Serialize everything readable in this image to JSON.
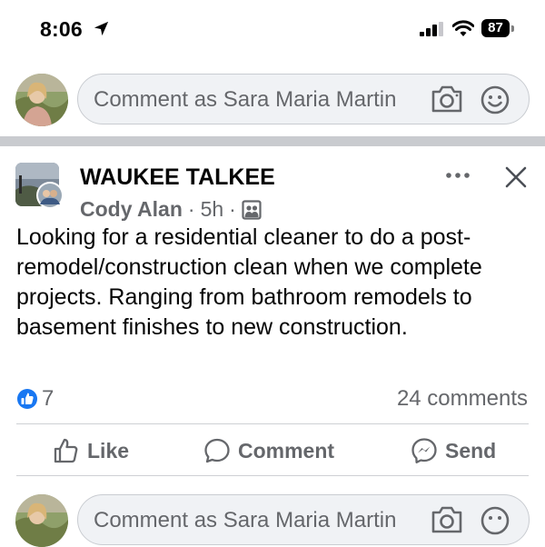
{
  "status_bar": {
    "time": "8:06",
    "battery": "87"
  },
  "top_comment": {
    "placeholder": "Comment as Sara Maria Martin"
  },
  "post": {
    "group_name": "WAUKEE TALKEE",
    "author": "Cody Alan",
    "separator": "·",
    "age": "5h",
    "text": "Looking for a residential cleaner to do a post-remodel/construction clean when we complete projects. Ranging from bathroom remodels to basement finishes to new construction.",
    "like_count": "7",
    "comment_count": "24 comments"
  },
  "actions": {
    "like": "Like",
    "comment": "Comment",
    "send": "Send"
  },
  "bottom_comment": {
    "placeholder": "Comment as Sara Maria Martin"
  },
  "colors": {
    "like_blue": "#1877f2",
    "muted": "#65676b"
  },
  "icons": [
    "location-arrow-icon",
    "signal-icon",
    "wifi-icon",
    "battery-icon",
    "camera-icon",
    "smiley-icon",
    "more-options-icon",
    "close-icon",
    "audience-group-icon",
    "like-reaction-icon",
    "thumbs-up-icon",
    "comment-bubble-icon",
    "messenger-send-icon"
  ]
}
